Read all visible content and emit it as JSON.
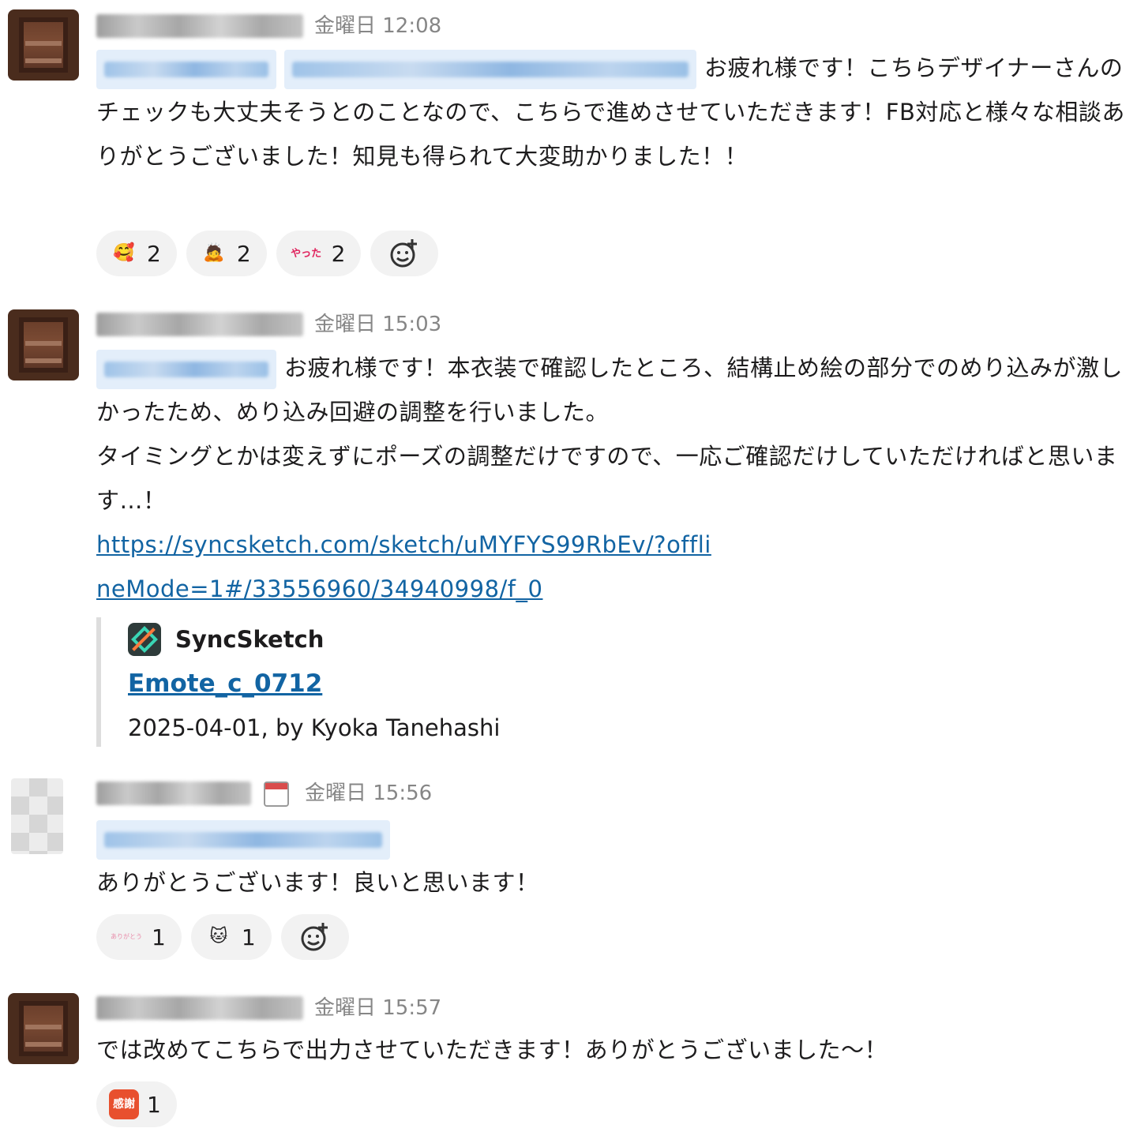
{
  "messages": [
    {
      "time": "金曜日 12:08",
      "text_after_mentions": "お疲れ様です！こちらデザイナーさんのチェックも大丈夫そうとのことなので、こちらで進めさせていただきます！FB対応と様々な相談ありがとうございました！知見も得られて大変助かりました！！",
      "reactions": [
        {
          "emoji_name": "smiling-face-with-hearts-icon",
          "glyph": "🥰",
          "count": "2"
        },
        {
          "emoji_name": "bowing-person-icon",
          "glyph": "🙇",
          "count": "2"
        },
        {
          "emoji_name": "yattaze-stamp-icon",
          "glyph": "やった",
          "count": "2"
        }
      ]
    },
    {
      "time": "金曜日 15:03",
      "text_after_mention": "お疲れ様です！本衣装で確認したところ、結構止め絵の部分でのめり込みが激しかったため、めり込み回避の調整を行いました。",
      "line2": "タイミングとかは変えずにポーズの調整だけですので、一応ご確認だけしていただければと思います…！",
      "link": "https://syncsketch.com/sketch/uMYFYS99RbEv/?offlineMode=1#/33556960/34940998/f_0",
      "attachment": {
        "service": "SyncSketch",
        "title": "Emote_c_0712",
        "meta": "2025-04-01, by Kyoka Tanehashi"
      }
    },
    {
      "time": "金曜日 15:56",
      "text": "ありがとうございます！良いと思います！",
      "reactions": [
        {
          "emoji_name": "arigatou-stamp-icon",
          "glyph": "ありがとう",
          "count": "1"
        },
        {
          "emoji_name": "cat-face-icon",
          "glyph": "🐱",
          "count": "1"
        }
      ]
    },
    {
      "time": "金曜日 15:57",
      "text": "では改めてこちらで出力させていただきます！ありがとうございました～！",
      "reactions": [
        {
          "emoji_name": "kansha-stamp-icon",
          "glyph": "感謝",
          "count": "1"
        }
      ]
    }
  ],
  "colors": {
    "link": "#1264a3",
    "mention_bg": "#e3eefa",
    "reaction_bg": "#f2f2f2",
    "timestamp": "#868686"
  }
}
